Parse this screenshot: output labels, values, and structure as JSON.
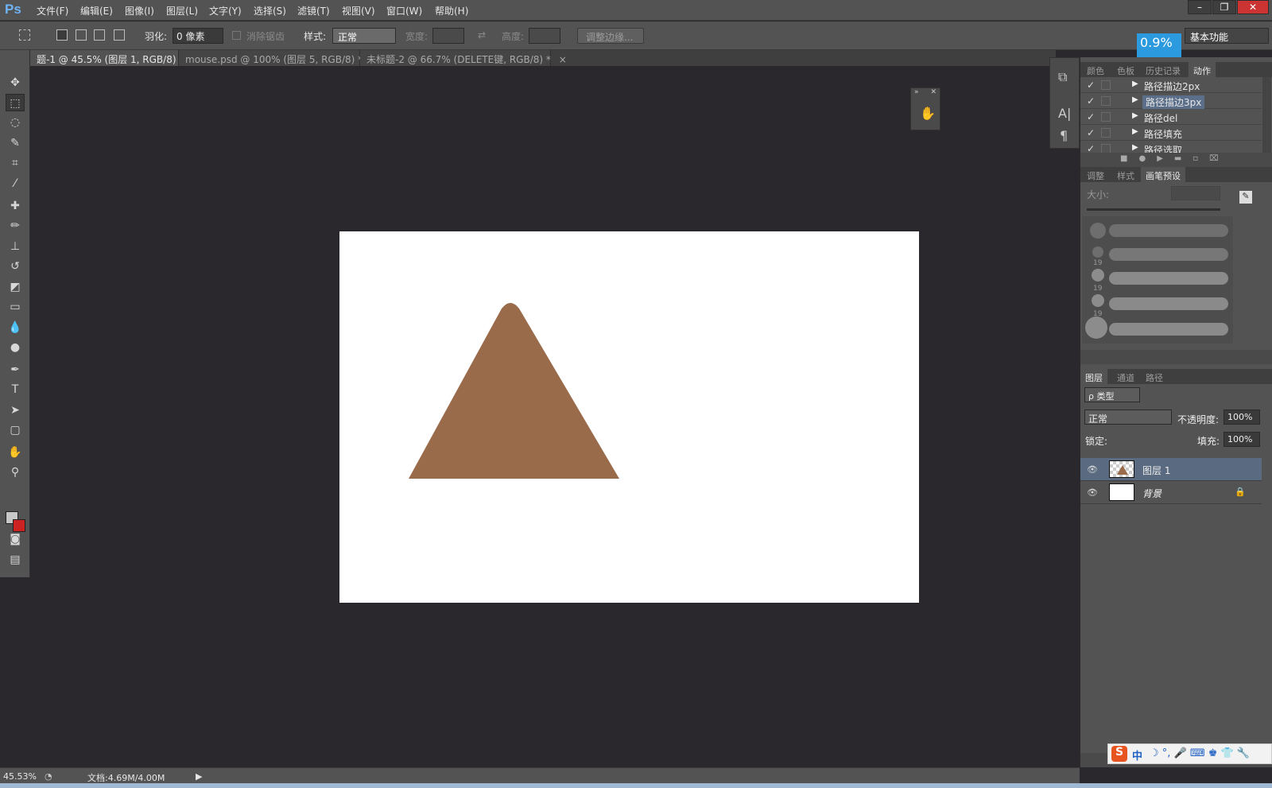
{
  "app": {
    "logo": "Ps"
  },
  "menu": [
    "文件(F)",
    "编辑(E)",
    "图像(I)",
    "图层(L)",
    "文字(Y)",
    "选择(S)",
    "滤镜(T)",
    "视图(V)",
    "窗口(W)",
    "帮助(H)"
  ],
  "window_buttons": [
    "–",
    "❐",
    "✕"
  ],
  "options": {
    "feather_label": "羽化:",
    "feather_value": "0 像素",
    "antialias_label": "消除锯齿",
    "style_label": "样式:",
    "style_value": "正常",
    "width_label": "宽度:",
    "height_label": "高度:",
    "refine_edge": "调整边缘...",
    "workspace": "基本功能"
  },
  "zoom_badge": "0.9%",
  "tabs": [
    "题-1 @ 45.5% (图层 1, RGB/8) *",
    "mouse.psd @ 100% (图层 5, RGB/8) *",
    "未标题-2 @ 66.7% (DELETE键, RGB/8) *"
  ],
  "tab_close": "×",
  "panel_tabs_top": [
    "颜色",
    "色板",
    "历史记录",
    "动作"
  ],
  "actions": [
    {
      "label": "路径描边2px",
      "checked": "✓"
    },
    {
      "label": "路径描边3px",
      "checked": "✓"
    },
    {
      "label": "路径del",
      "checked": "✓"
    },
    {
      "label": "路径填充",
      "checked": "✓"
    },
    {
      "label": "路径选取",
      "checked": "✓"
    }
  ],
  "panel_tabs_mid": [
    "调整",
    "样式",
    "画笔预设"
  ],
  "brush": {
    "size_label": "大小:",
    "sizes": [
      "19",
      "19",
      "19"
    ]
  },
  "panel_tabs_layers": [
    "图层",
    "通道",
    "路径"
  ],
  "layers_panel": {
    "filter_label": "ρ 类型",
    "blend_mode": "正常",
    "opacity_label": "不透明度:",
    "opacity_value": "100%",
    "lock_label": "锁定:",
    "fill_label": "填充:",
    "fill_value": "100%",
    "layers": [
      {
        "name": "图层 1"
      },
      {
        "name": "背景"
      }
    ]
  },
  "status": {
    "zoom": "45.53%",
    "doc": "文档:4.69M/4.00M"
  },
  "ime": {
    "mode": "中"
  },
  "colors": {
    "shape": "#996b4b",
    "foreground": "#c8c8c8",
    "background": "#cc2222",
    "accent": "#2b9adf"
  }
}
